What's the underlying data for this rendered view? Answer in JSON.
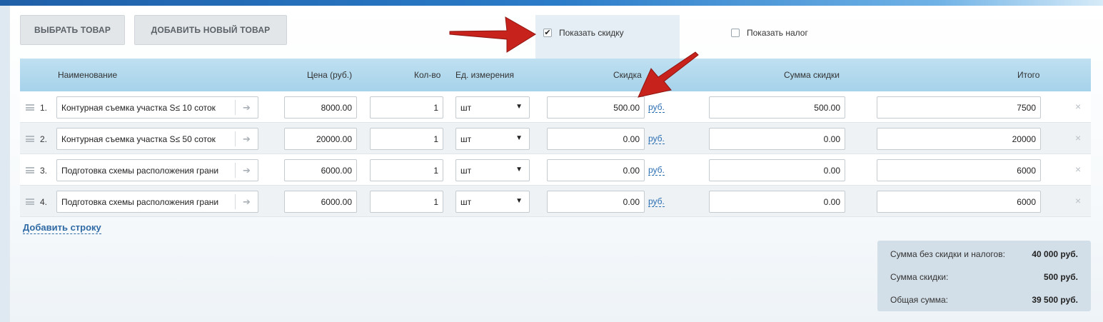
{
  "toolbar": {
    "select_product": "ВЫБРАТЬ ТОВАР",
    "add_new_product": "ДОБАВИТЬ НОВЫЙ ТОВАР",
    "show_discount": "Показать скидку",
    "show_discount_checked": true,
    "show_tax": "Показать налог",
    "show_tax_checked": false
  },
  "columns": {
    "name": "Наименование",
    "price": "Цена (руб.)",
    "qty": "Кол-во",
    "unit": "Ед. измерения",
    "discount": "Скидка",
    "discount_sum": "Сумма скидки",
    "total": "Итого"
  },
  "rows": [
    {
      "num": "1.",
      "name": "Контурная съемка участка S≤ 10 соток",
      "price": "8000.00",
      "qty": "1",
      "unit": "шт",
      "discount": "500.00",
      "currency": "руб.",
      "discount_sum": "500.00",
      "total": "7500"
    },
    {
      "num": "2.",
      "name": "Контурная съемка участка S≤ 50 соток",
      "price": "20000.00",
      "qty": "1",
      "unit": "шт",
      "discount": "0.00",
      "currency": "руб.",
      "discount_sum": "0.00",
      "total": "20000"
    },
    {
      "num": "3.",
      "name": "Подготовка схемы расположения грани",
      "price": "6000.00",
      "qty": "1",
      "unit": "шт",
      "discount": "0.00",
      "currency": "руб.",
      "discount_sum": "0.00",
      "total": "6000"
    },
    {
      "num": "4.",
      "name": "Подготовка схемы расположения грани",
      "price": "6000.00",
      "qty": "1",
      "unit": "шт",
      "discount": "0.00",
      "currency": "руб.",
      "discount_sum": "0.00",
      "total": "6000"
    }
  ],
  "add_row": "Добавить строку",
  "totals": {
    "subtotal_label": "Сумма без скидки и налогов:",
    "subtotal_value": "40 000 руб.",
    "discount_label": "Сумма скидки:",
    "discount_value": "500 руб.",
    "grand_label": "Общая сумма:",
    "grand_value": "39 500 руб."
  },
  "icons": {
    "arrow_right": "arrow-right-icon",
    "caret_down": "caret-down-icon",
    "delete": "close-icon",
    "drag": "drag-handle-icon"
  },
  "colors": {
    "header_bg": "#a6d2ea",
    "link": "#2b6fb3",
    "annotation_arrow": "#c8221c"
  }
}
